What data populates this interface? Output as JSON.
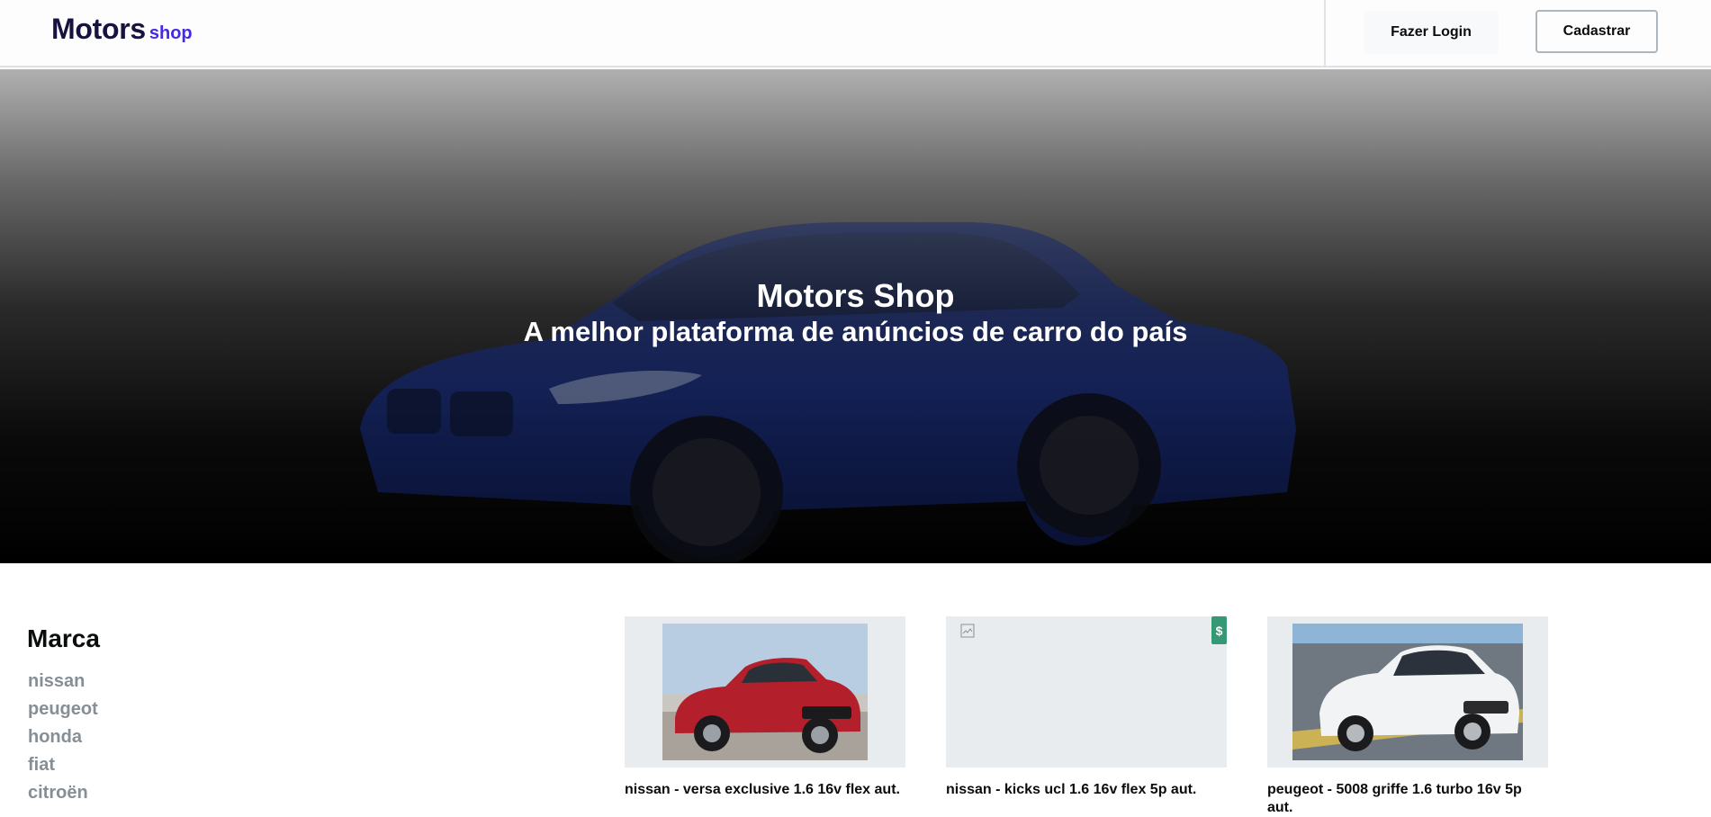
{
  "header": {
    "logo_main": "Motors",
    "logo_sub": "shop",
    "login_label": "Fazer Login",
    "register_label": "Cadastrar"
  },
  "hero": {
    "title": "Motors Shop",
    "subtitle": "A melhor plataforma de anúncios de carro do país"
  },
  "filters": {
    "title": "Marca",
    "items": [
      "nissan",
      "peugeot",
      "honda",
      "fiat",
      "citroën"
    ]
  },
  "cards": [
    {
      "title": "nissan - versa exclusive 1.6 16v flex aut.",
      "car_color": "#b3202b"
    },
    {
      "title": "nissan - kicks ucl 1.6 16v flex 5p aut.",
      "badge": "$"
    },
    {
      "title": "peugeot - 5008 griffe 1.6 turbo 16v 5p aut.",
      "car_color": "#f2f3f5"
    }
  ]
}
